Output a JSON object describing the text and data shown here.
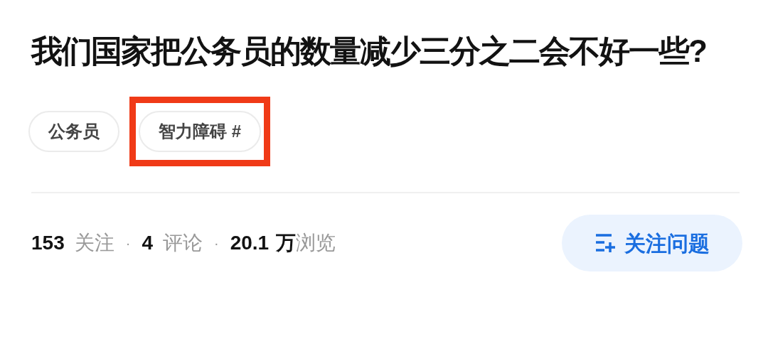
{
  "question": {
    "title": "我们国家把公务员的数量减少三分之二会不好一些?"
  },
  "tags": [
    {
      "label": "公务员",
      "highlighted": false
    },
    {
      "label": "智力障碍 #",
      "highlighted": true
    }
  ],
  "stats": {
    "separator": "·",
    "items": [
      {
        "number": "153",
        "label": "关注"
      },
      {
        "number": "4",
        "label": "评论"
      },
      {
        "number": "20.1",
        "unit": "万",
        "label": "浏览"
      }
    ]
  },
  "follow_button": {
    "label": "关注问题"
  }
}
